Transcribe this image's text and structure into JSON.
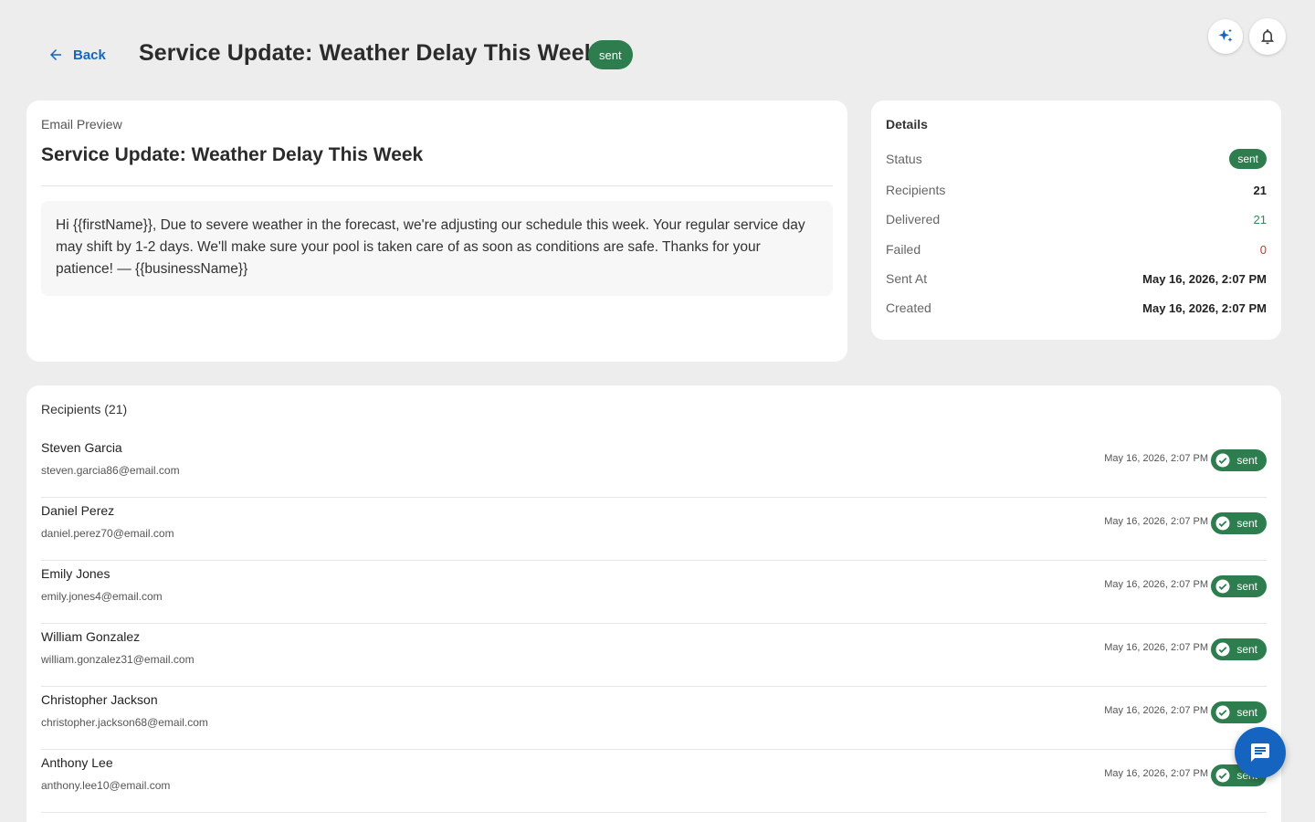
{
  "header": {
    "back_label": "Back",
    "title": "Service Update: Weather Delay This Week",
    "status": "sent"
  },
  "preview": {
    "label": "Email Preview",
    "subject": "Service Update: Weather Delay This Week",
    "body": "Hi {{firstName}}, Due to severe weather in the forecast, we're adjusting our schedule this week. Your regular service day may shift by 1-2 days. We'll make sure your pool is taken care of as soon as conditions are safe. Thanks for your patience! — {{businessName}}"
  },
  "details": {
    "title": "Details",
    "status_label": "Status",
    "status_value": "sent",
    "recipients_label": "Recipients",
    "recipients_value": "21",
    "delivered_label": "Delivered",
    "delivered_value": "21",
    "failed_label": "Failed",
    "failed_value": "0",
    "sent_at_label": "Sent At",
    "sent_at_value": "May 16, 2026, 2:07 PM",
    "created_label": "Created",
    "created_value": "May 16, 2026, 2:07 PM"
  },
  "recipients": {
    "title": "Recipients (21)",
    "items": [
      {
        "name": "Steven Garcia",
        "email": "steven.garcia86@email.com",
        "date": "May 16, 2026, 2:07 PM",
        "status": "sent"
      },
      {
        "name": "Daniel Perez",
        "email": "daniel.perez70@email.com",
        "date": "May 16, 2026, 2:07 PM",
        "status": "sent"
      },
      {
        "name": "Emily Jones",
        "email": "emily.jones4@email.com",
        "date": "May 16, 2026, 2:07 PM",
        "status": "sent"
      },
      {
        "name": "William Gonzalez",
        "email": "william.gonzalez31@email.com",
        "date": "May 16, 2026, 2:07 PM",
        "status": "sent"
      },
      {
        "name": "Christopher Jackson",
        "email": "christopher.jackson68@email.com",
        "date": "May 16, 2026, 2:07 PM",
        "status": "sent"
      },
      {
        "name": "Anthony Lee",
        "email": "anthony.lee10@email.com",
        "date": "May 16, 2026, 2:07 PM",
        "status": "sent"
      }
    ]
  },
  "colors": {
    "accent": "#1565c0",
    "success": "#2e7d4f",
    "danger": "#d32f2f"
  },
  "icons": {
    "back": "arrow-left-icon",
    "ai": "sparkle-icon",
    "notifications": "bell-icon",
    "recipient_status": "check-circle-icon",
    "chat": "chat-icon"
  }
}
